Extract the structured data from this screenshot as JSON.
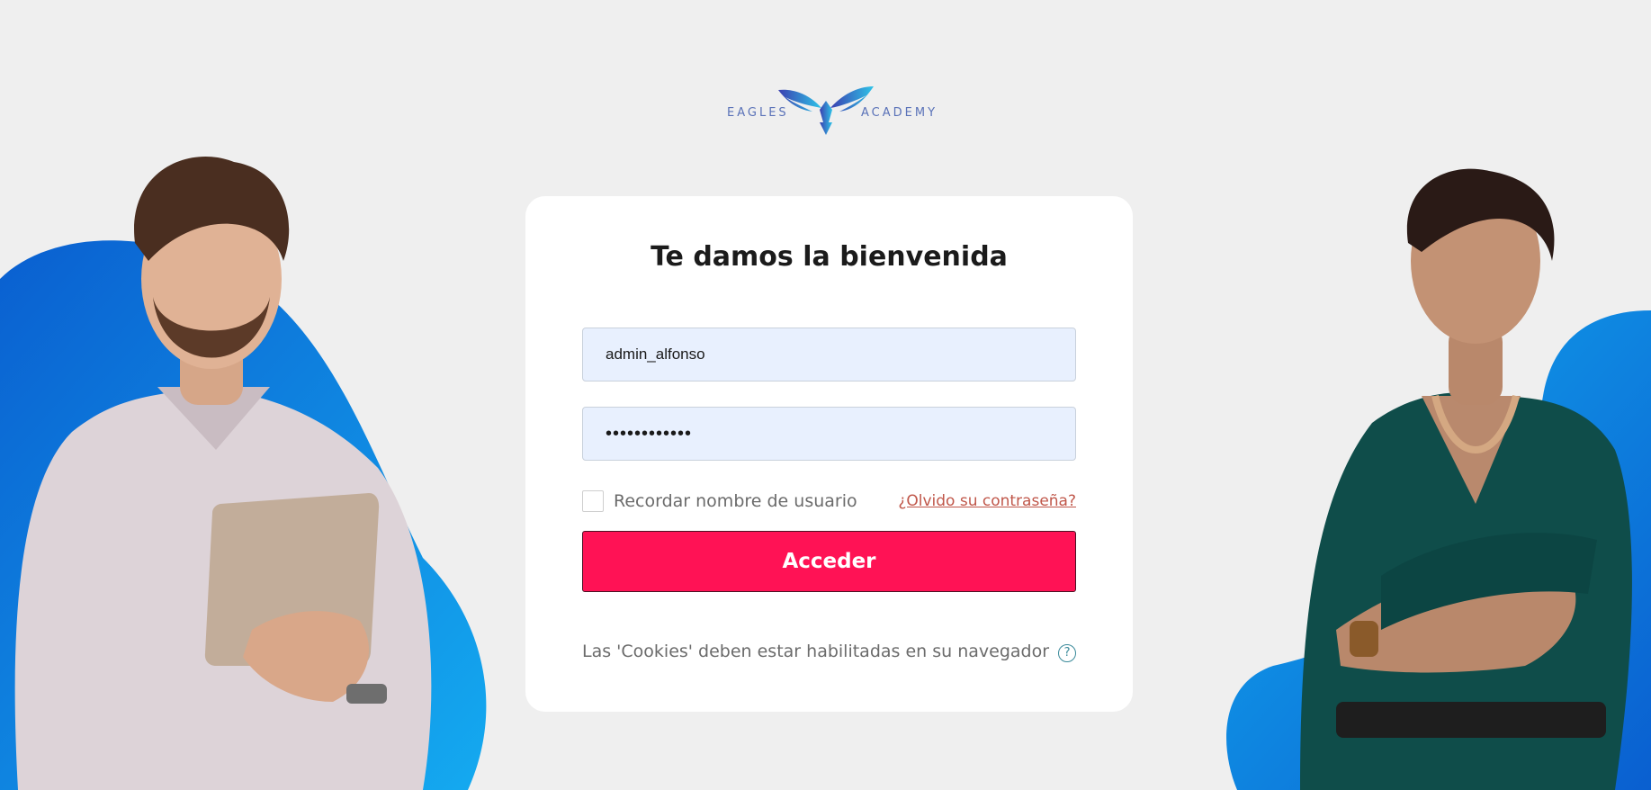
{
  "logo": {
    "word_left": "EAGLES",
    "word_right": "ACADEMY",
    "icon": "eagle-icon"
  },
  "login": {
    "title": "Te damos la bienvenida",
    "username_value": "admin_alfonso",
    "password_value": "••••••••••••",
    "remember_label": "Recordar nombre de usuario",
    "remember_checked": false,
    "forgot_link": "¿Olvido su contraseña?",
    "submit_label": "Acceder",
    "cookies_note": "Las 'Cookies' deben estar habilitadas en su navegador",
    "help_icon_glyph": "?"
  },
  "colors": {
    "background": "#efefef",
    "card": "#ffffff",
    "input_fill": "#e8f0fe",
    "submit": "#ff1255",
    "link": "#c0574a",
    "blob_blue": "#0a6bd6",
    "blob_cyan": "#12a7ee"
  }
}
